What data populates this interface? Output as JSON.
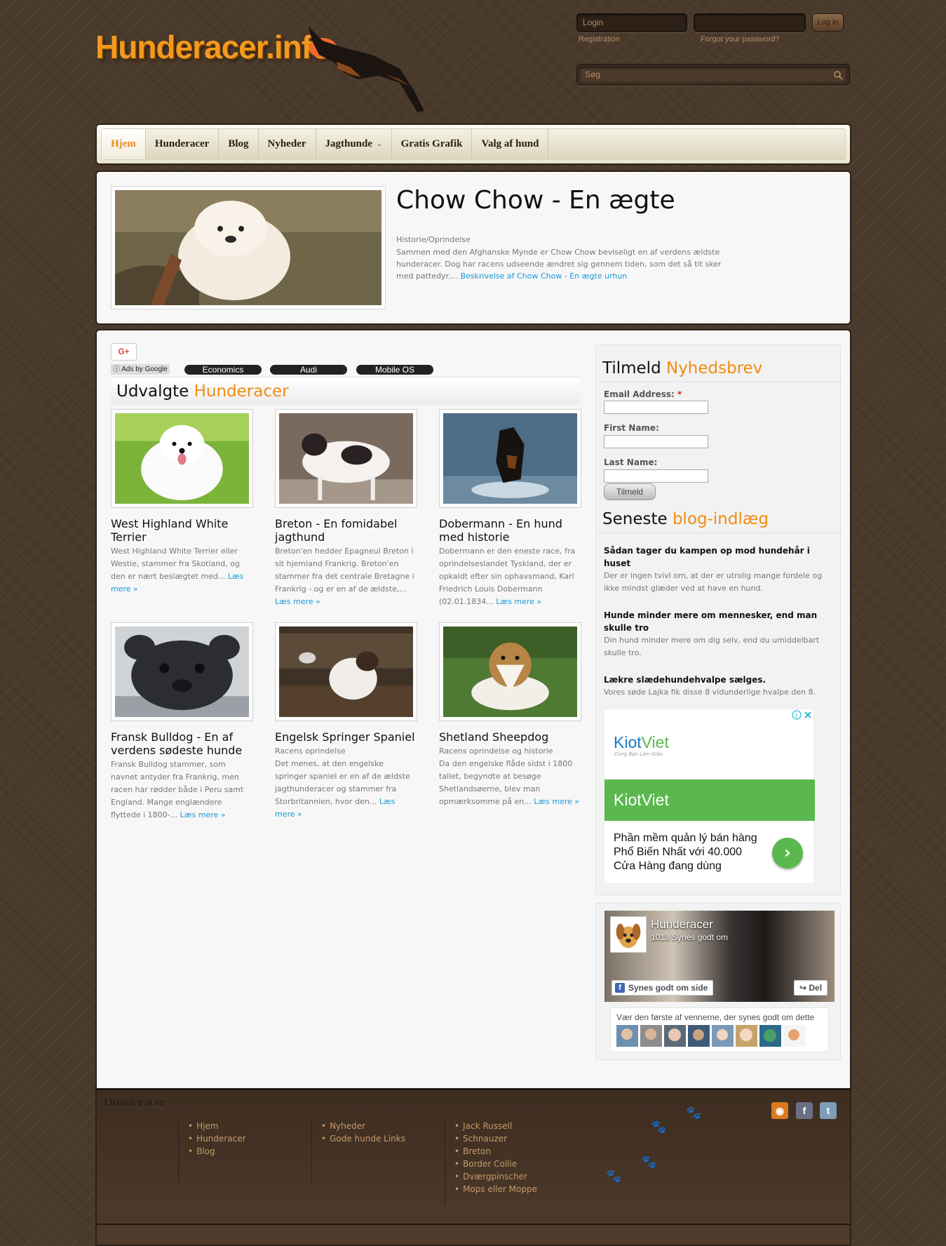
{
  "header": {
    "logo_text": "Hunderacer.info",
    "login_placeholder": "Login",
    "password_value": "",
    "login_button": "Log in",
    "registration_link": "Registration",
    "forgot_link": "Forgot your password?",
    "search_placeholder": "Søg"
  },
  "nav": {
    "items": [
      {
        "label": "Hjem",
        "active": true
      },
      {
        "label": "Hunderacer"
      },
      {
        "label": "Blog"
      },
      {
        "label": "Nyheder"
      },
      {
        "label": "Jagthunde",
        "has_dropdown": true
      },
      {
        "label": "Gratis Grafik"
      },
      {
        "label": "Valg af hund"
      }
    ]
  },
  "feature": {
    "title": "Chow Chow - En ægte",
    "subtitle": "Historie/Oprindelse",
    "text": "Sammen med den Afghanske Mynde er Chow Chow beviseligt en af verdens ældste hunderacer. Dog har racens udseende ændret sig gennem tiden, som det så tit sker med pattedyr.... ",
    "link": "Beskrivelse af Chow Chow - En ægte urhun"
  },
  "ads_bar": {
    "gplus": "G+",
    "adchoices": "Ads by Google",
    "pills": [
      "Economics",
      "Audi",
      "Mobile OS"
    ]
  },
  "featured": {
    "heading_black": "Udvalgte ",
    "heading_orange": "Hunderacer",
    "read_more": "Læs mere »",
    "cards": [
      {
        "title": "West Highland White Terrier",
        "text": "West Highland White Terrier eller Westie, stammer fra Skotland, og den er nært beslægtet med... "
      },
      {
        "title": "Breton - En fomidabel jagthund",
        "text": "Breton'en hedder Epagneul Breton i sit hjemland Frankrig. Breton'en stammer fra det centrale Bretagne i Frankrig - og er en af de ældste,... "
      },
      {
        "title": "Dobermann - En hund med historie",
        "text": "Dobermann er den eneste race, fra oprindelseslandet Tyskland, der er opkaldt efter sin ophavsmand, Karl Friedrich Louis Dobermann (02.01.1834... "
      },
      {
        "title": "Fransk Bulldog - En af verdens sødeste hunde",
        "text": "Fransk Bulldog stammer, som navnet antyder fra Frankrig, men racen har rødder både i Peru samt England. Mange englændere flyttede i 1800-... "
      },
      {
        "title": "Engelsk Springer Spaniel",
        "text": "Racens oprindelse\nDet menes, at den engelske springer spaniel er en af de ældste jagthunderacer og stammer fra Storbritannien, hvor den... "
      },
      {
        "title": "Shetland Sheepdog",
        "text": "Racens oprindelse og historie\nDa den engelske flåde sidst i 1800 tallet, begyndte at besøge Shetlandsøerne, blev man opmærksomme på en... "
      }
    ]
  },
  "newsletter": {
    "heading_black": "Tilmeld ",
    "heading_orange": "Nyhedsbrev",
    "email_label": "Email Address: ",
    "required_mark": "*",
    "first_name_label": "First Name:",
    "last_name_label": "Last Name:",
    "submit": "Tilmeld"
  },
  "blog": {
    "heading_black": "Seneste ",
    "heading_orange": "blog-indlæg",
    "posts": [
      {
        "title": "Sådan tager du kampen op mod hundehår i huset",
        "text": "Der er ingen tvivl om, at der er utrolig mange fordele og ikke mindst glæder ved at have en hund."
      },
      {
        "title": "Hunde minder mere om mennesker, end man skulle tro",
        "text": "Din hund minder mere om dig selv, end du umiddelbart skulle tro."
      },
      {
        "title": "Lækre slædehundehvalpe sælges.",
        "text": "Vores søde Lajka fik disse 8 vidunderlige hvalpe den 8."
      }
    ]
  },
  "ad": {
    "brand_a": "Kiot",
    "brand_b": "Viet",
    "tagline": "Cùng Bạn Làm Giàu",
    "banner": "KiotViet",
    "body": "Phần mềm quản lý bán hàng Phổ Biến Nhất với 40.000 Cửa Hàng đang dùng"
  },
  "facebook": {
    "page_name": "Hunderacer",
    "likes": "1013 Synes godt om",
    "like_button": "Synes godt om side",
    "share_button": "Del",
    "friends_text": "Vær den første af vennerne, der synes godt om dette"
  },
  "footer": {
    "title": "Hunderacer",
    "col1": [
      "Hjem",
      "Hunderacer",
      "Blog"
    ],
    "col2": [
      "Nyheder",
      "Gode hunde Links"
    ],
    "col3": [
      "Jack Russell",
      "Schnauzer",
      "Breton",
      "Border Collie",
      "Dværgpinscher",
      "Mops eller Moppe"
    ]
  },
  "colors": {
    "accent": "#f08c12",
    "link": "#1a9ad6",
    "background": "#4a3a2c",
    "kiotviet_green": "#5bb84e"
  }
}
